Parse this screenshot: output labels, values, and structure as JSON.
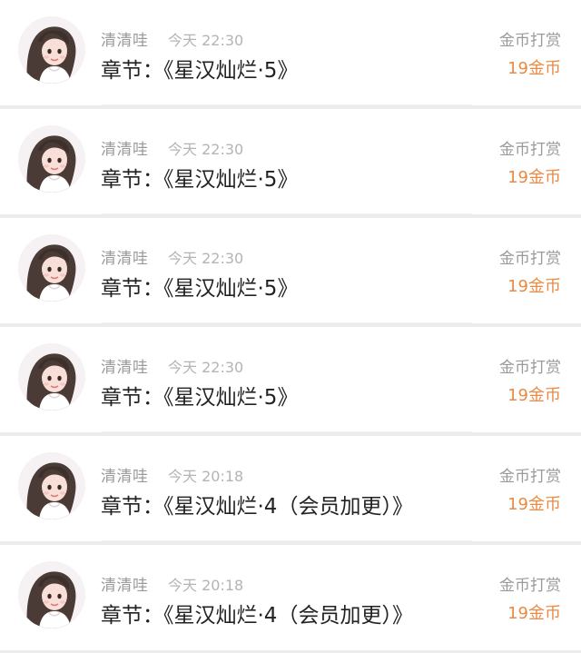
{
  "list": {
    "items": [
      {
        "name": "清清哇",
        "time": "今天 22:30",
        "chapter": "章节：《星汉灿烂·5》",
        "action": "金币打赏",
        "reward": "19金币"
      },
      {
        "name": "清清哇",
        "time": "今天 22:30",
        "chapter": "章节：《星汉灿烂·5》",
        "action": "金币打赏",
        "reward": "19金币"
      },
      {
        "name": "清清哇",
        "time": "今天 22:30",
        "chapter": "章节：《星汉灿烂·5》",
        "action": "金币打赏",
        "reward": "19金币"
      },
      {
        "name": "清清哇",
        "time": "今天 22:30",
        "chapter": "章节：《星汉灿烂·5》",
        "action": "金币打赏",
        "reward": "19金币"
      },
      {
        "name": "清清哇",
        "time": "今天 20:18",
        "chapter": "章节：《星汉灿烂·4（会员加更）》",
        "action": "金币打赏",
        "reward": "19金币"
      },
      {
        "name": "清清哇",
        "time": "今天 20:18",
        "chapter": "章节：《星汉灿烂·4（会员加更）》",
        "action": "金币打赏",
        "reward": "19金币"
      }
    ]
  },
  "colors": {
    "background": "#ececee",
    "card": "#ffffff",
    "name_text": "#9a9a9a",
    "time_text": "#b4b4b4",
    "chapter_text": "#222222",
    "reward_accent": "#ea8a42"
  },
  "icons": {
    "avatar": "avatar-illustration"
  }
}
